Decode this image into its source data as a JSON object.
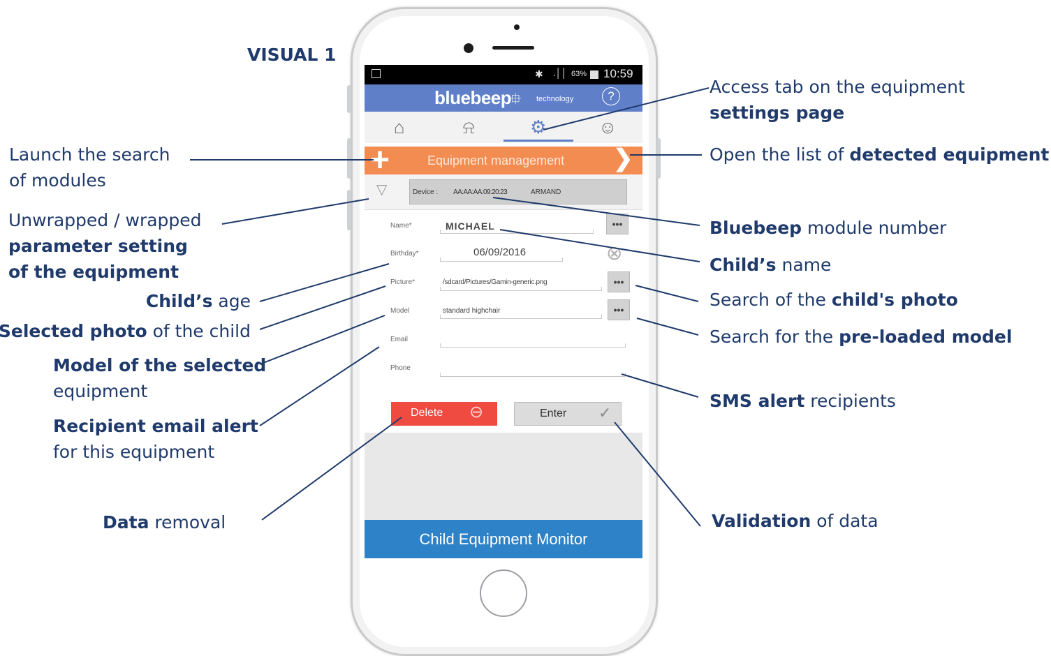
{
  "visual_title": "VISUAL 1",
  "status": {
    "bluetooth": "✱",
    "signal": ".││",
    "battery": "63%",
    "time": "10:59"
  },
  "app": {
    "brand": "bluebeep",
    "brand_suffix": "technology",
    "help": "?"
  },
  "tabs": [
    {
      "name": "home",
      "icon": "⌂"
    },
    {
      "name": "alerts",
      "icon": "⍾"
    },
    {
      "name": "settings",
      "icon": "⚙"
    },
    {
      "name": "profile",
      "icon": "☺"
    }
  ],
  "equipment_bar": {
    "add": "+",
    "title": "Equipment management",
    "next": "❯"
  },
  "device": {
    "toggle": "▽",
    "label": "Device :",
    "id": "AA:AA:AA:09:20:23",
    "name": "ARMAND"
  },
  "form": {
    "name_label": "Name*",
    "name_value": "MICHAEL",
    "birthday_label": "Birthday*",
    "birthday_value": "06/09/2016",
    "picture_label": "Picture*",
    "picture_value": "/sdcard/Pictures/Gamin-generic.png",
    "model_label": "Model",
    "model_value": "standard highchair",
    "email_label": "Email",
    "email_value": "",
    "phone_label": "Phone",
    "phone_value": "",
    "dots": "•••",
    "clear": "⊗"
  },
  "buttons": {
    "delete": "Delete",
    "delete_icon": "⊖",
    "enter": "Enter",
    "enter_icon": "✓"
  },
  "footer": "Child Equipment Monitor",
  "annotations": {
    "launch_search": {
      "line1": "Launch the search",
      "line2": "of modules"
    },
    "unwrapped": {
      "line1": "Unwrapped / wrapped",
      "line2": "parameter setting",
      "line3": "of the equipment"
    },
    "age": {
      "bold": "Child’s",
      "rest": " age"
    },
    "photo": {
      "bold": "Selected photo",
      "rest": " of the child"
    },
    "model": {
      "line1": "Model of the selected",
      "line2": "equipment"
    },
    "email": {
      "line1": "Recipient email alert",
      "line2": "for this equipment"
    },
    "removal": {
      "bold": "Data",
      "rest": " removal"
    },
    "access_tab": {
      "line1": "Access tab on the equipment",
      "line2": "settings page"
    },
    "open_list": {
      "plain": "Open the list of ",
      "bold": "detected equipment"
    },
    "module_number": {
      "bold": "Bluebeep",
      "rest": " module number"
    },
    "child_name": {
      "bold": "Child’s",
      "rest": " name"
    },
    "search_photo": {
      "plain": "Search of the ",
      "bold": "child's photo"
    },
    "search_model": {
      "plain": "Search for the ",
      "bold": "pre-loaded model"
    },
    "sms": {
      "bold": "SMS alert",
      "rest": " recipients"
    },
    "validation": {
      "bold": "Validation",
      "rest": " of data"
    }
  },
  "colors": {
    "annotation": "#1f3a6b",
    "app_bar": "#5f7fc8",
    "orange_bar": "#f28c50",
    "delete": "#ef4b41",
    "footer": "#2d82c8"
  }
}
